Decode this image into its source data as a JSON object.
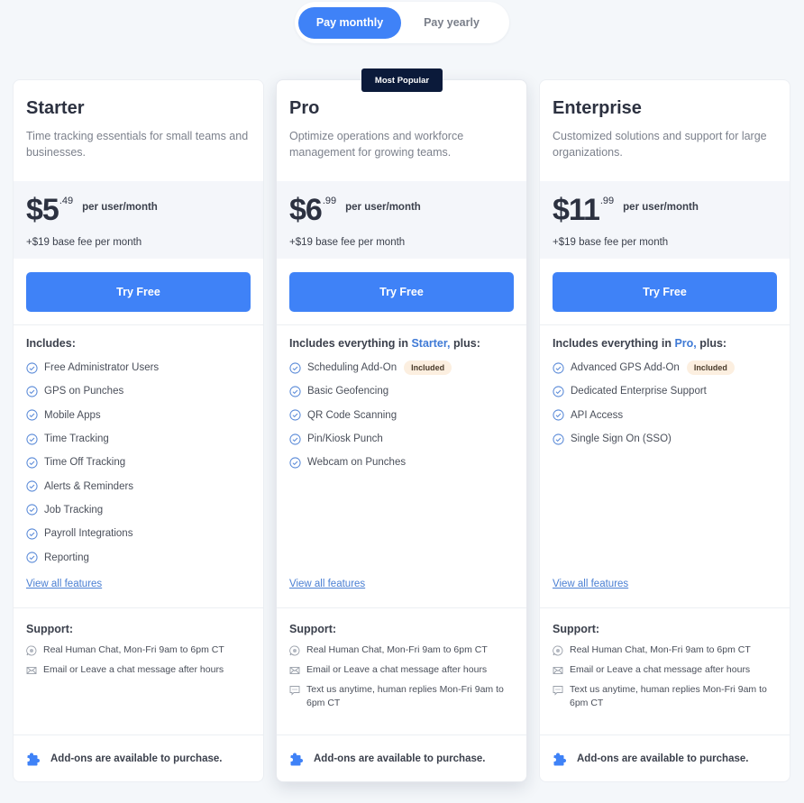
{
  "billing_toggle": {
    "options": [
      {
        "label": "Pay monthly",
        "active": true
      },
      {
        "label": "Pay yearly",
        "active": false
      }
    ]
  },
  "colors": {
    "accent": "#3f82f7",
    "badge_bg": "#0b1a3a",
    "link": "#4a7fd3",
    "pill_bg": "#fcefe0"
  },
  "plans": [
    {
      "name": "Starter",
      "badge": null,
      "description": "Time tracking essentials for small teams and businesses.",
      "price_dollars": "$5",
      "price_cents": ".49",
      "price_unit": "per user/month",
      "base_fee": "+$19 base fee per month",
      "cta_label": "Try Free",
      "features_prefix": "Includes:",
      "features_highlight": "",
      "features_suffix": "",
      "features": [
        {
          "label": "Free Administrator Users",
          "pill": ""
        },
        {
          "label": "GPS on Punches",
          "pill": ""
        },
        {
          "label": "Mobile Apps",
          "pill": ""
        },
        {
          "label": "Time Tracking",
          "pill": ""
        },
        {
          "label": "Time Off Tracking",
          "pill": ""
        },
        {
          "label": "Alerts & Reminders",
          "pill": ""
        },
        {
          "label": "Job Tracking",
          "pill": ""
        },
        {
          "label": "Payroll Integrations",
          "pill": ""
        },
        {
          "label": "Reporting",
          "pill": ""
        }
      ],
      "view_all_label": "View all features",
      "support_title": "Support:",
      "support": [
        {
          "icon": "chat-icon",
          "label": "Real Human Chat, Mon-Fri 9am to 6pm CT"
        },
        {
          "icon": "mail-icon",
          "label": "Email or Leave a chat message after hours"
        }
      ],
      "addons_label": "Add-ons are available to purchase."
    },
    {
      "name": "Pro",
      "badge": "Most Popular",
      "description": "Optimize operations and workforce management for growing teams.",
      "price_dollars": "$6",
      "price_cents": ".99",
      "price_unit": "per user/month",
      "base_fee": "+$19 base fee per month",
      "cta_label": "Try Free",
      "features_prefix": "Includes everything in ",
      "features_highlight": "Starter,",
      "features_suffix": " plus:",
      "features": [
        {
          "label": "Scheduling Add-On",
          "pill": "Included"
        },
        {
          "label": "Basic Geofencing",
          "pill": ""
        },
        {
          "label": "QR Code Scanning",
          "pill": ""
        },
        {
          "label": "Pin/Kiosk Punch",
          "pill": ""
        },
        {
          "label": "Webcam on Punches",
          "pill": ""
        }
      ],
      "view_all_label": "View all features",
      "support_title": "Support:",
      "support": [
        {
          "icon": "chat-icon",
          "label": "Real Human Chat, Mon-Fri 9am to 6pm CT"
        },
        {
          "icon": "mail-icon",
          "label": "Email or Leave a chat message after hours"
        },
        {
          "icon": "sms-icon",
          "label": "Text us anytime, human replies Mon-Fri 9am to 6pm CT"
        }
      ],
      "addons_label": "Add-ons are available to purchase."
    },
    {
      "name": "Enterprise",
      "badge": null,
      "description": "Customized solutions and support for large organizations.",
      "price_dollars": "$11",
      "price_cents": ".99",
      "price_unit": "per user/month",
      "base_fee": "+$19 base fee per month",
      "cta_label": "Try Free",
      "features_prefix": "Includes everything in ",
      "features_highlight": "Pro,",
      "features_suffix": " plus:",
      "features": [
        {
          "label": "Advanced GPS Add-On",
          "pill": "Included"
        },
        {
          "label": "Dedicated Enterprise Support",
          "pill": ""
        },
        {
          "label": "API Access",
          "pill": ""
        },
        {
          "label": "Single Sign On (SSO)",
          "pill": ""
        }
      ],
      "view_all_label": "View all features",
      "support_title": "Support:",
      "support": [
        {
          "icon": "chat-icon",
          "label": "Real Human Chat, Mon-Fri 9am to 6pm CT"
        },
        {
          "icon": "mail-icon",
          "label": "Email or Leave a chat message after hours"
        },
        {
          "icon": "sms-icon",
          "label": "Text us anytime, human replies Mon-Fri 9am to 6pm CT"
        }
      ],
      "addons_label": "Add-ons are available to purchase."
    }
  ]
}
